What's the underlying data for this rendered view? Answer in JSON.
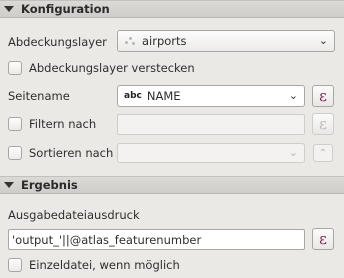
{
  "konfiguration": {
    "title": "Konfiguration",
    "coverage_layer_label": "Abdeckungslayer",
    "coverage_layer_value": "airports",
    "hide_coverage_label": "Abdeckungslayer verstecken",
    "page_name_label": "Seitename",
    "page_name_type": "abc",
    "page_name_value": "NAME",
    "filter_label": "Filtern nach",
    "filter_value": "",
    "sort_label": "Sortieren nach",
    "sort_value": ""
  },
  "ergebnis": {
    "title": "Ergebnis",
    "output_expr_label": "Ausgabedateiausdruck",
    "output_expr_value": "'output_'||@atlas_featurenumber",
    "single_file_label": "Einzeldatei, wenn möglich"
  },
  "icons": {
    "expression": "ε",
    "chevron": "⌄",
    "sort_up": "⌃"
  },
  "colors": {
    "expression_icon": "#7a2a55"
  }
}
